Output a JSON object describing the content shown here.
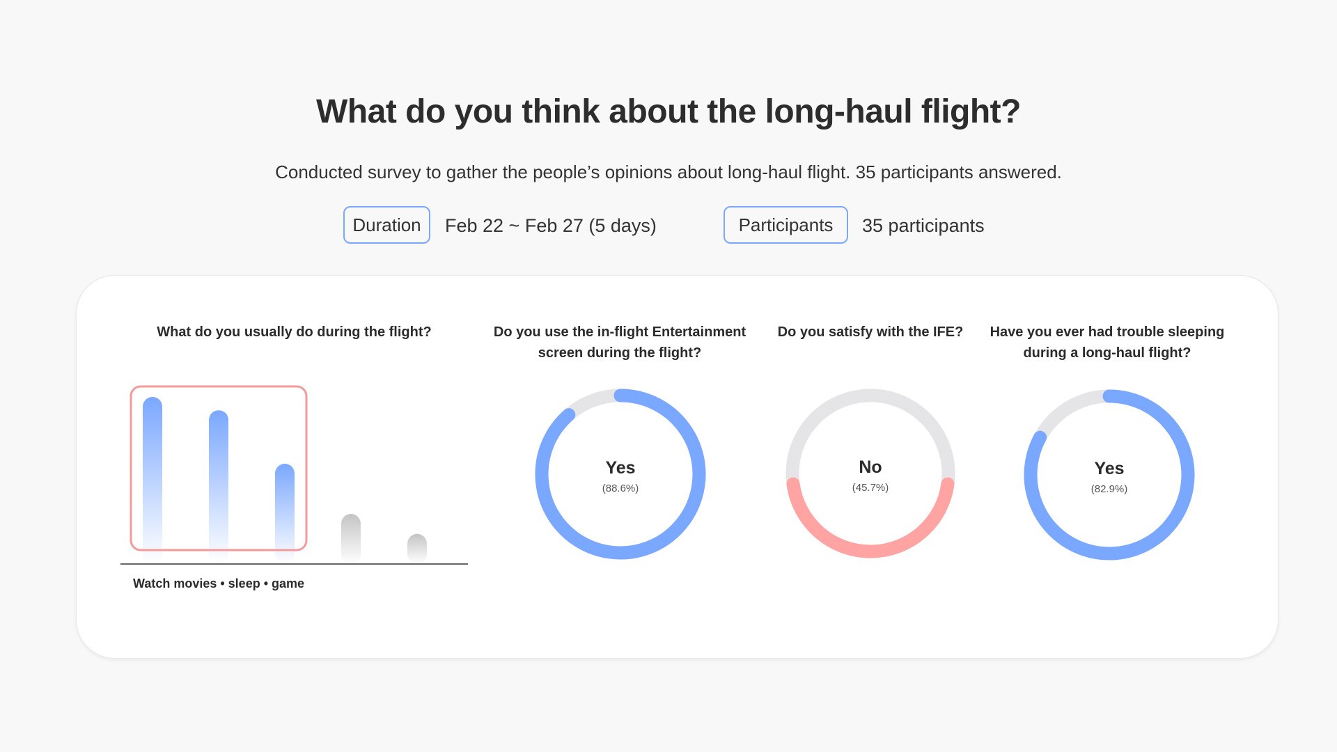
{
  "header": {
    "title": "What do you think about the long-haul flight?",
    "subtitle": "Conducted survey to gather the people’s opinions about long-haul flight. 35 participants answered."
  },
  "meta": {
    "duration_label": "Duration",
    "duration_value": "Feb 22 ~ Feb 27 (5 days)",
    "participants_label": "Participants",
    "participants_value": "35 participants"
  },
  "colors": {
    "accent_blue": "#7aa7ff",
    "accent_red": "#ffa3a3",
    "track_gray": "#e5e5e7",
    "highlight_border": "#f49a9a"
  },
  "chart_data": [
    {
      "type": "bar",
      "title": "What do you usually do during the flight?",
      "caption": "Watch movies • sleep • game",
      "values": [
        1.0,
        0.92,
        0.6,
        0.3,
        0.18
      ],
      "highlighted_count": 3
    },
    {
      "type": "pie",
      "title": "Do you use the in-flight Entertainment screen during the flight?",
      "answer": "Yes",
      "percent_label": "(88.6%)",
      "value": 88.6,
      "color": "#7aa7ff"
    },
    {
      "type": "pie",
      "title": "Do you satisfy with  the IFE?",
      "answer": "No",
      "percent_label": "(45.7%)",
      "value": 45.7,
      "color": "#ffa3a3"
    },
    {
      "type": "pie",
      "title": "Have you ever had trouble sleeping during a long-haul flight?",
      "answer": "Yes",
      "percent_label": "(82.9%)",
      "value": 82.9,
      "color": "#7aa7ff"
    }
  ]
}
